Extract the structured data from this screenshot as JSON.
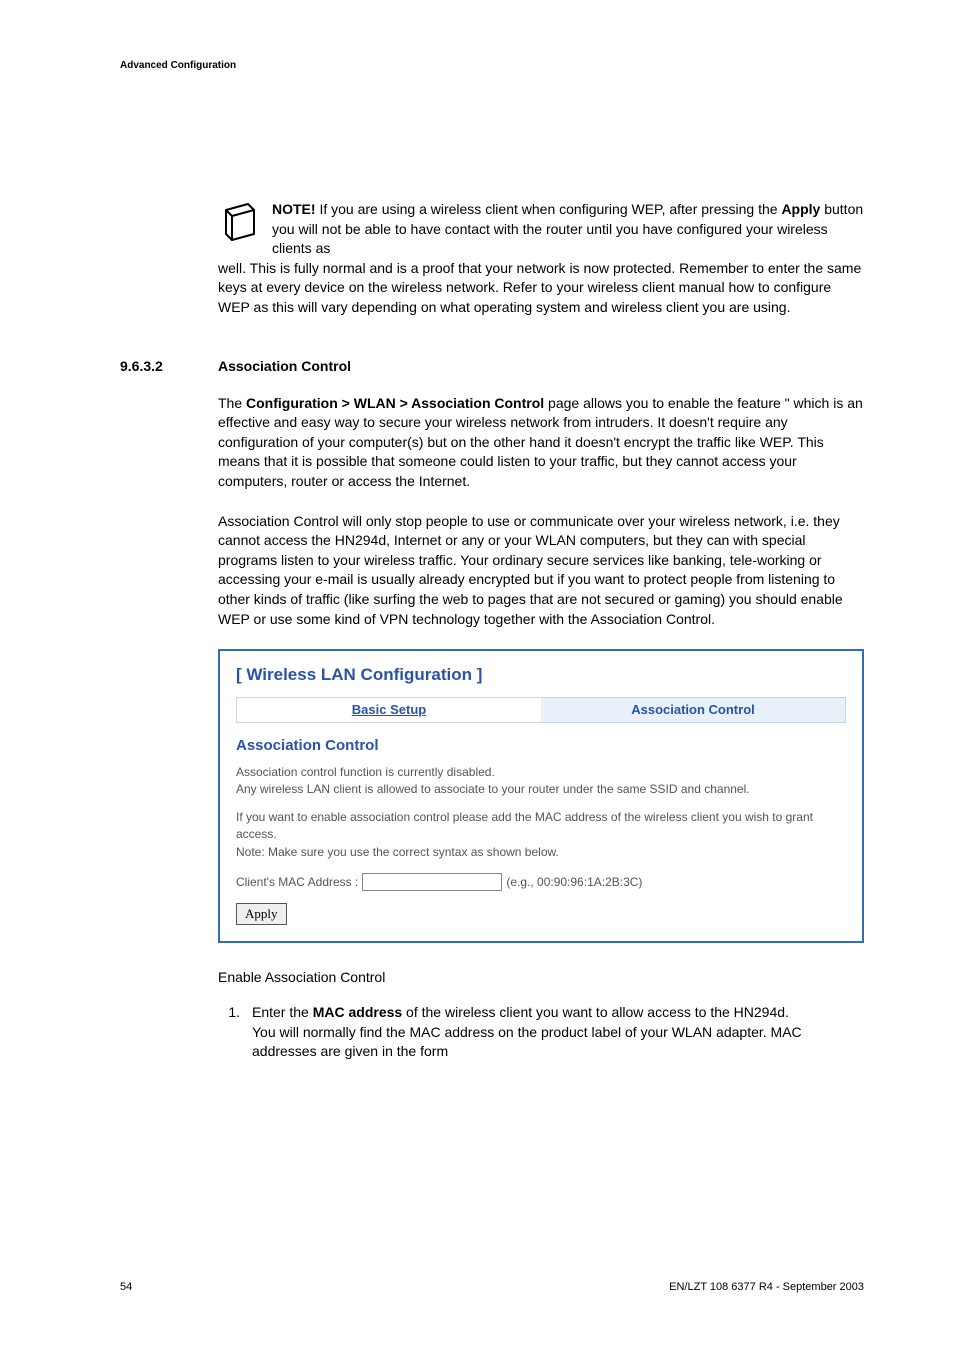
{
  "header": {
    "title": "Advanced Configuration"
  },
  "note": {
    "heading": "NOTE!",
    "line_a": " If you are using a wireless client when configuring WEP, after pressing the ",
    "apply_word": "Apply",
    "line_b": " button you will not be able to have contact with the router until you have configured your wireless clients as ",
    "rest": "well. This is fully normal and is a proof that your network is now protected. Remember to enter the same keys at every device on the wireless network. Refer to your wireless client manual how to configure WEP as this will vary depending on what operating system and wireless client you are using."
  },
  "section": {
    "number": "9.6.3.2",
    "title": "Association Control"
  },
  "para1": {
    "lead": "The ",
    "bold": "Configuration > WLAN > Association Control",
    "rest": " page allows you to enable the feature \" which is an effective and easy way to secure your wireless network from intruders. It doesn't require any configuration of your computer(s) but on the other hand it doesn't encrypt the traffic like WEP. This means that it is possible that someone could listen to your traffic, but they cannot access your computers, router or access the Internet."
  },
  "para2": {
    "text": "Association Control will only stop people to use or communicate over your wireless network, i.e. they cannot access the HN294d, Internet or any or your WLAN computers, but they can with special programs listen to your wireless traffic. Your ordinary secure services like banking, tele-working or accessing your e-mail is usually already encrypted but if you want to protect people from listening to other kinds of traffic (like surfing the web to pages that are not secured or gaming) you should enable WEP or use some kind of VPN technology together with the Association Control."
  },
  "screenshot": {
    "title": "[ Wireless LAN Configuration ]",
    "tab_basic": "Basic Setup",
    "tab_assoc": "Association Control",
    "subtitle": "Association Control",
    "text1": "Association control function is currently disabled.",
    "text2": "Any wireless LAN client is allowed to associate to your router under the same SSID and channel.",
    "note_text": "If you want to enable association control please add the MAC address of the wireless client you wish to grant access.",
    "note_line2": "Note: Make sure you use the correct syntax as shown below.",
    "mac_label": "Client's MAC Address :",
    "mac_hint": "(e.g., 00:90:96:1A:2B:3C)",
    "apply_btn": "Apply"
  },
  "enable_label": "Enable Association Control",
  "ol": {
    "num": "1.",
    "body_a": "Enter the ",
    "body_bold": "MAC address",
    "body_b": " of the wireless client you want to allow access to the HN294d.",
    "body_c": "You will normally find the MAC address on the product label of your WLAN adapter. MAC addresses are given in the form"
  },
  "footer": {
    "page": "54",
    "docref": "EN/LZT 108 6377 R4 - September 2003"
  }
}
